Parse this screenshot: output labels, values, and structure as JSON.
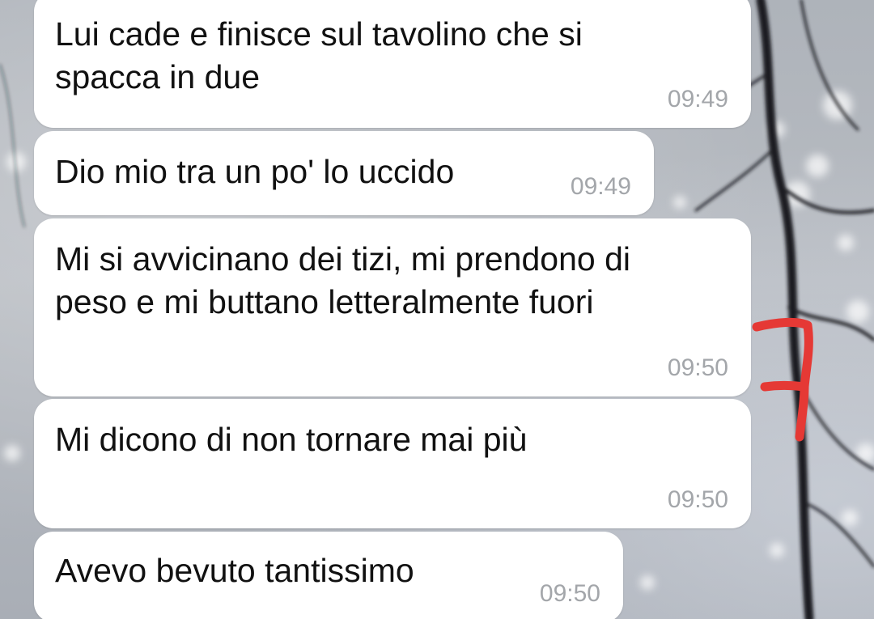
{
  "chat": {
    "messages": [
      {
        "text": "Lui cade e finisce sul tavolino che si\nspacca in due",
        "time": "09:49"
      },
      {
        "text": "Dio mio tra un po' lo uccido",
        "time": "09:49"
      },
      {
        "text": "Mi si avvicinano dei tizi, mi prendono di\npeso e mi buttano letteralmente fuori",
        "time": "09:50"
      },
      {
        "text": "Mi dicono di non tornare mai più",
        "time": "09:50"
      },
      {
        "text": "Avevo bevuto tantissimo",
        "time": "09:50"
      }
    ]
  },
  "colors": {
    "bubble": "#ffffff",
    "message_text": "#111111",
    "timestamp": "#a3a6aa",
    "annotation_mark": "#e53935"
  },
  "decorations": {
    "wallpaper": "bokeh-branches-image",
    "annotation": "red-hand-drawn-bracket-icon"
  }
}
